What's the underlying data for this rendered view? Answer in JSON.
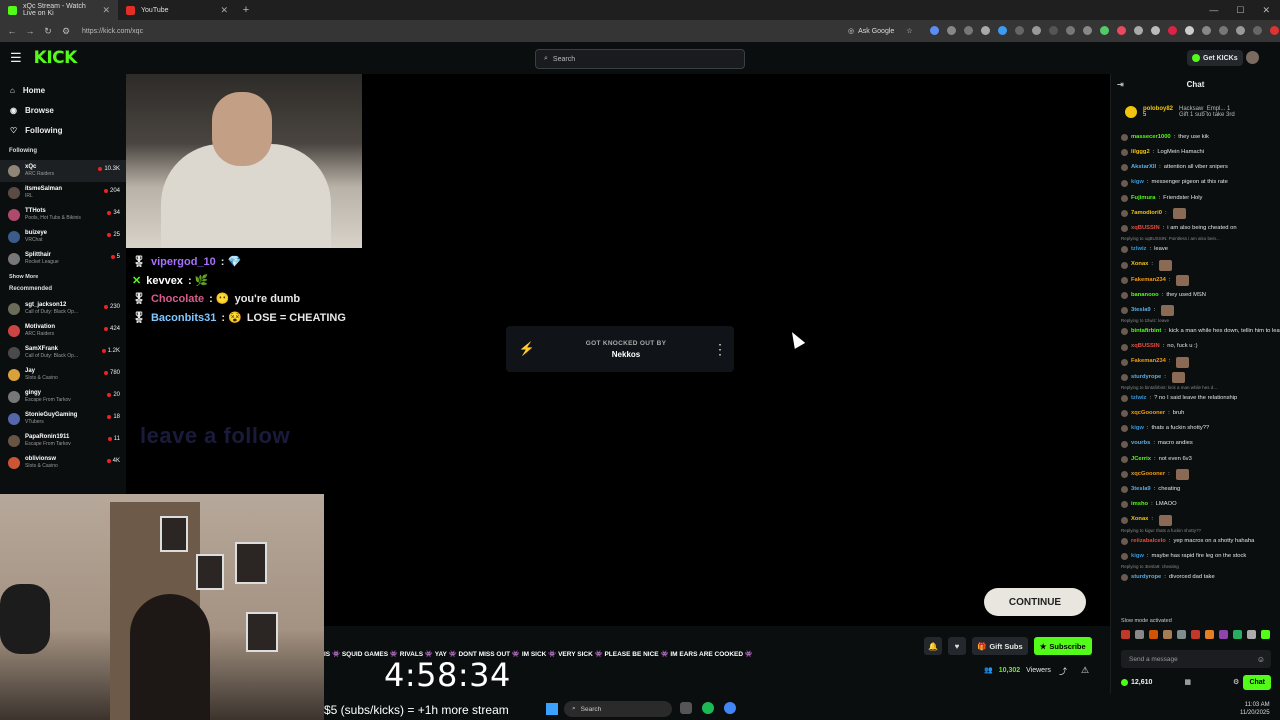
{
  "browser": {
    "tabs": [
      {
        "title": "xQc Stream - Watch Live on Ki",
        "active": true
      },
      {
        "title": "YouTube",
        "active": false
      }
    ],
    "url": "https://kick.com/xqc",
    "ask_google": "Ask Google"
  },
  "kick": {
    "logo": "KICK",
    "search_placeholder": "Search",
    "get_kicks": "Get KICKs"
  },
  "sidebar": {
    "nav": [
      "Home",
      "Browse",
      "Following"
    ],
    "following_title": "Following",
    "following": [
      {
        "name": "xQc",
        "game": "ARC Raiders",
        "viewers": "10.3K"
      },
      {
        "name": "itsmeSalman",
        "game": "IRL",
        "viewers": "204"
      },
      {
        "name": "TTHots",
        "game": "Pools, Hot Tubs & Bikinis",
        "viewers": "34"
      },
      {
        "name": "buizeye",
        "game": "VRChat",
        "viewers": "25"
      },
      {
        "name": "Splitthair",
        "game": "Rocket League",
        "viewers": "5"
      }
    ],
    "show_more": "Show More",
    "recommended_title": "Recommended",
    "recommended": [
      {
        "name": "sgt_jackson12",
        "game": "Call of Duty: Black Op...",
        "viewers": "230"
      },
      {
        "name": "Motivation",
        "game": "ARC Raiders",
        "viewers": "424"
      },
      {
        "name": "SamXFrank",
        "game": "Call of Duty: Black Op...",
        "viewers": "1.2K"
      },
      {
        "name": "Jay",
        "game": "Slots & Casino",
        "viewers": "780"
      },
      {
        "name": "gingy",
        "game": "Escape From Tarkov",
        "viewers": "20"
      },
      {
        "name": "StonieGuyGaming",
        "game": "VTubers",
        "viewers": "18"
      },
      {
        "name": "PapaRonin1911",
        "game": "Escape From Tarkov",
        "viewers": "11"
      },
      {
        "name": "oblivionsw",
        "game": "Slots & Casino",
        "viewers": "4K"
      }
    ]
  },
  "stream": {
    "overlay_chat": [
      {
        "user": "vipergod_10",
        "text": "",
        "color": "#a970ff"
      },
      {
        "user": "kevvex",
        "text": "",
        "color": "#ffffff"
      },
      {
        "user": "Chocolate",
        "text": "you're dumb",
        "color": "#d95a8e"
      },
      {
        "user": "Baconbits31",
        "text": "LOSE = CHEATING",
        "color": "#7ec8ff"
      }
    ],
    "knocked_label": "GOT KNOCKED OUT BY",
    "knocked_by": "Nekkos",
    "follow_text": "leave a follow",
    "continue": "CONTINUE",
    "ticker": "IS 👾 SQUID GAMES 👾 RIVALS 👾 YAY 👾 DONT MISS OUT 👾 IM SICK 👾 VERY SICK 👾 PLEASE BE NICE 👾 IM EARS ARE COOKED 👾",
    "timer": "4:58:34",
    "subs_text": "$5 (subs/kicks) = +1h more stream",
    "viewers": "10,302",
    "viewers_label": "Viewers",
    "gift_subs": "Gift Subs",
    "subscribe": "Subscribe"
  },
  "taskbar": {
    "search": "Search",
    "time": "11:03 AM",
    "date": "11/20/2025"
  },
  "chat": {
    "title": "Chat",
    "pinned": {
      "user": "poloboy82",
      "count": "5",
      "gifter": "Hacksaw_Empl...",
      "gift_count": "1",
      "note": "Gift 1 sub to take 3rd"
    },
    "messages": [
      {
        "user": "massecer1000",
        "text": "they use kik",
        "color": "#53fc18"
      },
      {
        "user": "lilggg2",
        "text": "LogMein Hamachi",
        "color": "#f1c40f"
      },
      {
        "user": "AkstarXII",
        "text": "attention all viber snipers",
        "color": "#5dade2"
      },
      {
        "user": "kigw",
        "text": "messenger pigeon at this rate",
        "color": "#3498db"
      },
      {
        "user": "Fujimura",
        "text": "Friendster Holy",
        "color": "#53fc18"
      },
      {
        "user": "7amodiori0",
        "text": "",
        "color": "#f1c40f"
      },
      {
        "user": "xqBUSSIN",
        "text": "i am also being cheated on",
        "color": "#e74c3c"
      },
      {
        "user": "tzlwiz",
        "text": "leave",
        "color": "#3498db",
        "reply": "Replying to xqBUSSIN: Pointless i am also bein..."
      },
      {
        "user": "Xonax",
        "text": "",
        "color": "#f1c40f"
      },
      {
        "user": "Fakeman234",
        "text": "",
        "color": "#f39c12"
      },
      {
        "user": "bananooo",
        "text": "they used MSN",
        "color": "#53fc18"
      },
      {
        "user": "3tesla9",
        "text": "",
        "color": "#5dade2"
      },
      {
        "user": "bintafirbint",
        "text": "kick a man while hes down, tellin him to leave chat like that",
        "color": "#53fc18",
        "reply": "Replying to tzlwiz: leave"
      },
      {
        "user": "xqBUSSIN",
        "text": "no, fuck u :)",
        "color": "#e74c3c"
      },
      {
        "user": "Fakeman234",
        "text": "",
        "color": "#f39c12"
      },
      {
        "user": "sturdyrope",
        "text": "",
        "color": "#5dade2"
      },
      {
        "user": "tzlwiz",
        "text": "? no I said leave the relationship",
        "color": "#3498db",
        "reply": "Replying to bintafirbint: kick a man while hes d..."
      },
      {
        "user": "xqcGoooner",
        "text": "bruh",
        "color": "#f39c12"
      },
      {
        "user": "kigw",
        "text": "thats a fuckin shotty??",
        "color": "#3498db"
      },
      {
        "user": "vourbs",
        "text": "macro andies",
        "color": "#5dade2"
      },
      {
        "user": "JCerrix",
        "text": "not even 6v3",
        "color": "#53fc18"
      },
      {
        "user": "xqcGoooner",
        "text": "",
        "color": "#f39c12"
      },
      {
        "user": "3tesla9",
        "text": "cheating",
        "color": "#5dade2"
      },
      {
        "user": "imsho",
        "text": "LMAOO",
        "color": "#53fc18"
      },
      {
        "user": "Xonax",
        "text": "",
        "color": "#f1c40f"
      },
      {
        "user": "reiizabalcelo",
        "text": "yep macros on a shotty hahaha",
        "color": "#e74c3c",
        "reply": "Replying to kigw: thats a fuckin shotty??"
      },
      {
        "user": "kigw",
        "text": "maybe has rapid fire leg on the stock",
        "color": "#3498db"
      },
      {
        "user": "sturdyrope",
        "text": "divorced dad take",
        "color": "#5dade2",
        "reply": "Replying to 3tesla9: cheating"
      }
    ],
    "slow_mode": "Slow mode activated",
    "input_placeholder": "Send a message",
    "points": "12,610",
    "chat_button": "Chat"
  }
}
